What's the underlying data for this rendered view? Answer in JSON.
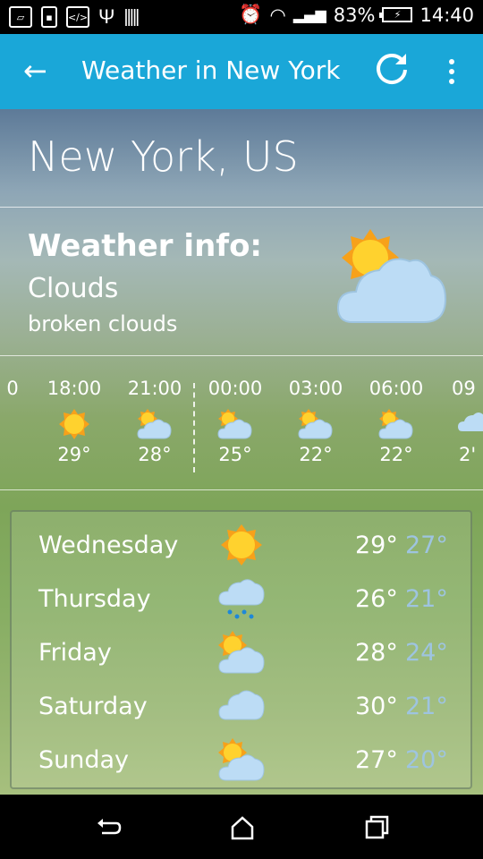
{
  "status_bar": {
    "battery": "83%",
    "time": "14:40",
    "icons": [
      "image-icon",
      "lock-icon",
      "code-icon",
      "usb-icon",
      "barcode-icon"
    ],
    "right_icons": [
      "alarm-icon",
      "wifi-icon",
      "signal-icon",
      "battery-icon"
    ]
  },
  "app_bar": {
    "title": "Weather in New York",
    "back": "back-arrow-icon",
    "refresh": "refresh-icon",
    "menu": "more-vert-icon",
    "color": "#1aa7d8"
  },
  "location": {
    "name": "New York, US"
  },
  "weather_info": {
    "heading": "Weather info:",
    "main": "Clouds",
    "description": "broken clouds",
    "icon": "sun-cloud-icon"
  },
  "hourly": [
    {
      "time": "0",
      "icon": "",
      "temp": ""
    },
    {
      "time": "18:00",
      "icon": "sun",
      "temp": "29°"
    },
    {
      "time": "21:00",
      "icon": "sun-cloud",
      "temp": "28°"
    },
    {
      "time": "00:00",
      "icon": "sun-cloud",
      "temp": "25°"
    },
    {
      "time": "03:00",
      "icon": "sun-cloud",
      "temp": "22°"
    },
    {
      "time": "06:00",
      "icon": "sun-cloud",
      "temp": "22°"
    },
    {
      "time": "09",
      "icon": "rain",
      "temp": "2'"
    }
  ],
  "daily": [
    {
      "day": "Wednesday",
      "icon": "sun",
      "high": "29°",
      "low": "27°"
    },
    {
      "day": "Thursday",
      "icon": "rain",
      "high": "26°",
      "low": "21°"
    },
    {
      "day": "Friday",
      "icon": "sun-cloud",
      "high": "28°",
      "low": "24°"
    },
    {
      "day": "Saturday",
      "icon": "cloud",
      "high": "30°",
      "low": "21°"
    },
    {
      "day": "Sunday",
      "icon": "sun-cloud",
      "high": "27°",
      "low": "20°"
    }
  ],
  "nav": [
    "back-nav-icon",
    "home-nav-icon",
    "recents-nav-icon"
  ]
}
